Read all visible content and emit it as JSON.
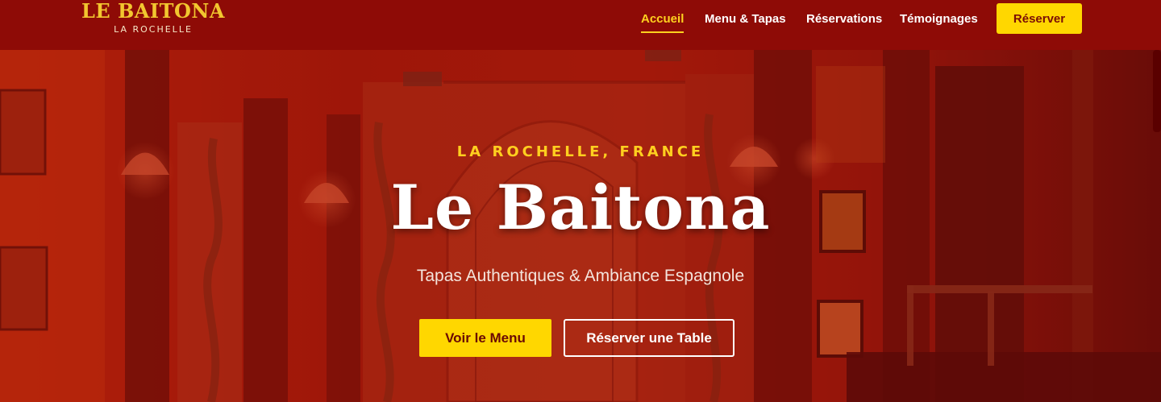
{
  "header": {
    "brand_name": "LE BAITONA",
    "brand_city": "LA ROCHELLE",
    "nav": [
      "Accueil",
      "Menu & Tapas",
      "Réservations",
      "Témoignages"
    ],
    "cta_label": "Réserver"
  },
  "hero": {
    "eyebrow": "LA ROCHELLE, FRANCE",
    "title": "Le Baitona",
    "tagline": "Tapas Authentiques & Ambiance Espagnole",
    "primary_button": "Voir le Menu",
    "secondary_button": "Réserver une Table"
  },
  "colors": {
    "header_bg": "#8e0b06",
    "accent_yellow": "#ffd700",
    "hero_overlay": "#a01208"
  }
}
